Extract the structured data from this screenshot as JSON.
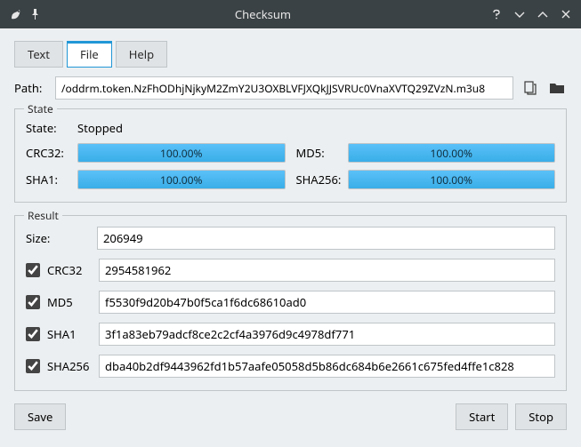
{
  "window": {
    "title": "Checksum"
  },
  "tabs": {
    "text": "Text",
    "file": "File",
    "help": "Help",
    "active": "file"
  },
  "path": {
    "label": "Path:",
    "value": "/oddrm.token.NzFhODhjNjkyM2ZmY2U3OXBLVFJXQkJJSVRUc0VnaXVTQ29ZVzN.m3u8"
  },
  "state": {
    "legend": "State",
    "state_label": "State:",
    "state_value": "Stopped",
    "crc32_label": "CRC32:",
    "crc32_progress": "100.00%",
    "md5_label": "MD5:",
    "md5_progress": "100.00%",
    "sha1_label": "SHA1:",
    "sha1_progress": "100.00%",
    "sha256_label": "SHA256:",
    "sha256_progress": "100.00%"
  },
  "result": {
    "legend": "Result",
    "size_label": "Size:",
    "size_value": "206949",
    "crc32_label": "CRC32",
    "crc32_checked": true,
    "crc32_value": "2954581962",
    "md5_label": "MD5",
    "md5_checked": true,
    "md5_value": "f5530f9d20b47b0f5ca1f6dc68610ad0",
    "sha1_label": "SHA1",
    "sha1_checked": true,
    "sha1_value": "3f1a83eb79adcf8ce2c2cf4a3976d9c4978df771",
    "sha256_label": "SHA256",
    "sha256_checked": true,
    "sha256_value": "dba40b2df9443962fd1b57aafe05058d5b86dc684b6e2661c675fed4ffe1c828"
  },
  "buttons": {
    "save": "Save",
    "start": "Start",
    "stop": "Stop"
  }
}
